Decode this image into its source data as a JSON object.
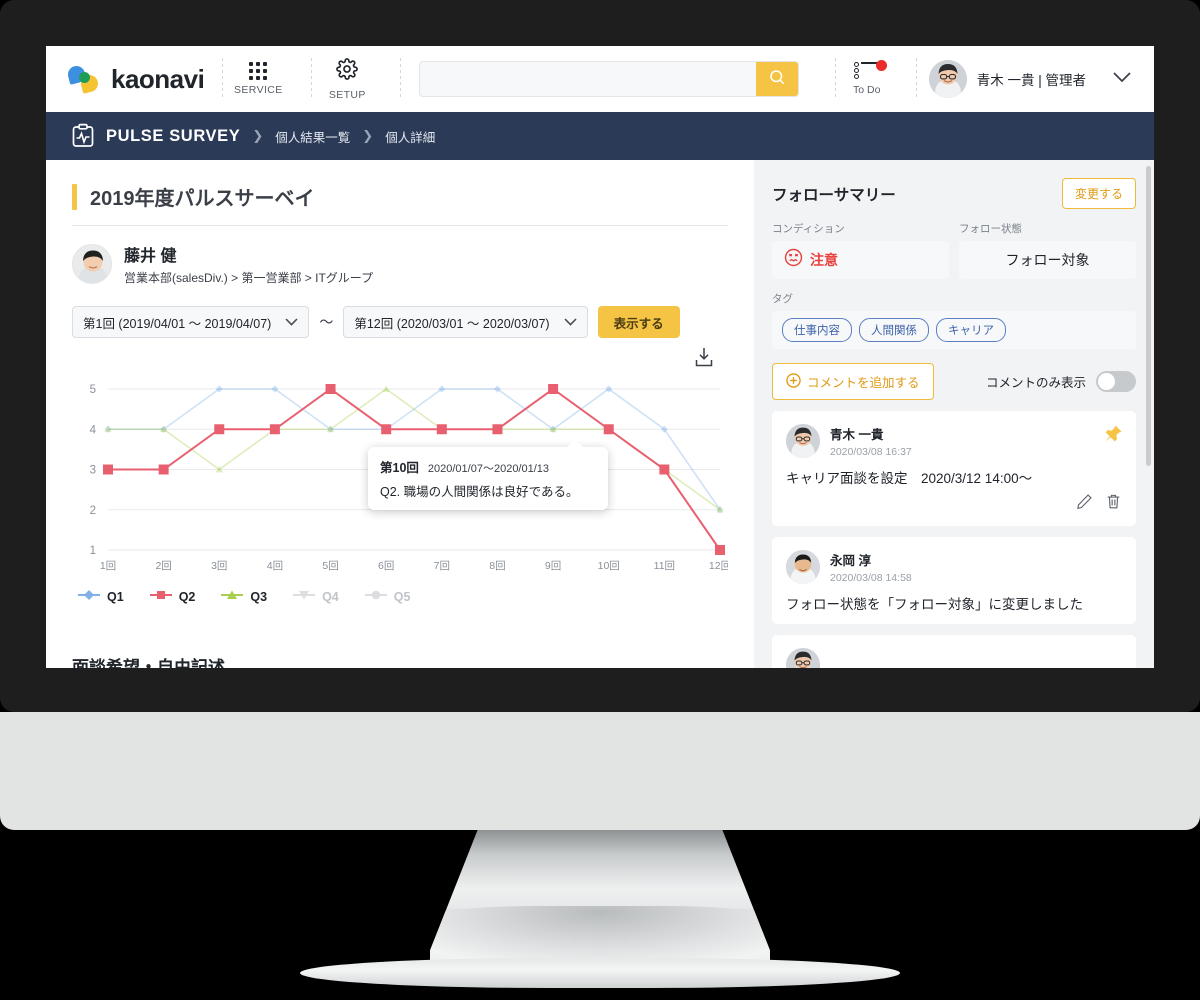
{
  "header": {
    "logo_text": "kaonavi",
    "service_label": "SERVICE",
    "setup_label": "SETUP",
    "search_placeholder": "",
    "search_value": "",
    "todo_label": "To Do",
    "user_name": "青木 一貴 | 管理者"
  },
  "breadcrumb": {
    "title": "PULSE SURVEY",
    "sep": "❯",
    "items": [
      {
        "label": "個人結果一覧"
      },
      {
        "label": "個人詳細"
      }
    ]
  },
  "main": {
    "page_title": "2019年度パルスサーベイ",
    "person": {
      "name": "藤井 健",
      "org": "営業本部(salesDiv.) > 第一営業部 > ITグループ"
    },
    "filter": {
      "from": "第1回 (2019/04/01 〜 2019/04/07)",
      "tilde": "〜",
      "to": "第12回 (2020/03/01 〜 2020/03/07)",
      "show_button": "表示する"
    },
    "tooltip": {
      "round": "第10回",
      "period": "2020/01/07〜2020/01/13",
      "question": "Q2. 職場の人間関係は良好である。"
    },
    "section_heading": "面談希望・自由記述"
  },
  "chart_data": {
    "type": "line",
    "title": "",
    "xlabel": "",
    "ylabel": "",
    "ylim": [
      1,
      5
    ],
    "yticks": [
      1,
      2,
      3,
      4,
      5
    ],
    "grid": true,
    "legend_position": "bottom",
    "categories": [
      "1回",
      "2回",
      "3回",
      "4回",
      "5回",
      "6回",
      "7回",
      "8回",
      "9回",
      "10回",
      "11回",
      "12回"
    ],
    "series": [
      {
        "name": "Q1",
        "color": "#7fb0e8",
        "marker": "diamond",
        "active": true,
        "values": [
          4,
          4,
          5,
          5,
          4,
          4,
          5,
          5,
          4,
          5,
          4,
          2
        ]
      },
      {
        "name": "Q2",
        "color": "#e8606f",
        "marker": "square",
        "active": true,
        "values": [
          3,
          3,
          4,
          4,
          5,
          4,
          4,
          4,
          5,
          4,
          3,
          1
        ]
      },
      {
        "name": "Q3",
        "color": "#a8cf4e",
        "marker": "triangle",
        "active": true,
        "values": [
          4,
          4,
          3,
          4,
          4,
          5,
          4,
          4,
          4,
          4,
          3,
          2
        ]
      },
      {
        "name": "Q4",
        "color": "#c9ccd1",
        "marker": "triangle-down",
        "active": false,
        "values": []
      },
      {
        "name": "Q5",
        "color": "#c9ccd1",
        "marker": "circle",
        "active": false,
        "values": []
      }
    ]
  },
  "sidebar": {
    "title": "フォローサマリー",
    "change_button": "変更する",
    "condition_label": "コンディション",
    "condition_value": "注意",
    "follow_label": "フォロー状態",
    "follow_value": "フォロー対象",
    "tag_label": "タグ",
    "tags": [
      "仕事内容",
      "人間関係",
      "キャリア"
    ],
    "add_comment": "コメントを追加する",
    "only_comments_label": "コメントのみ表示",
    "comments": [
      {
        "author": "青木 一貴",
        "timestamp": "2020/03/08  16:37",
        "body": "キャリア面談を設定　2020/3/12 14:00〜",
        "pinned": true
      },
      {
        "author": "永岡 淳",
        "timestamp": "2020/03/08  14:58",
        "body": "フォロー状態を「フォロー対象」に変更しました",
        "pinned": false
      }
    ]
  },
  "colors": {
    "brand_yellow": "#f6c445",
    "navy": "#2b3a57",
    "alert_red": "#e8413f",
    "tag_blue": "#3f63ab"
  }
}
